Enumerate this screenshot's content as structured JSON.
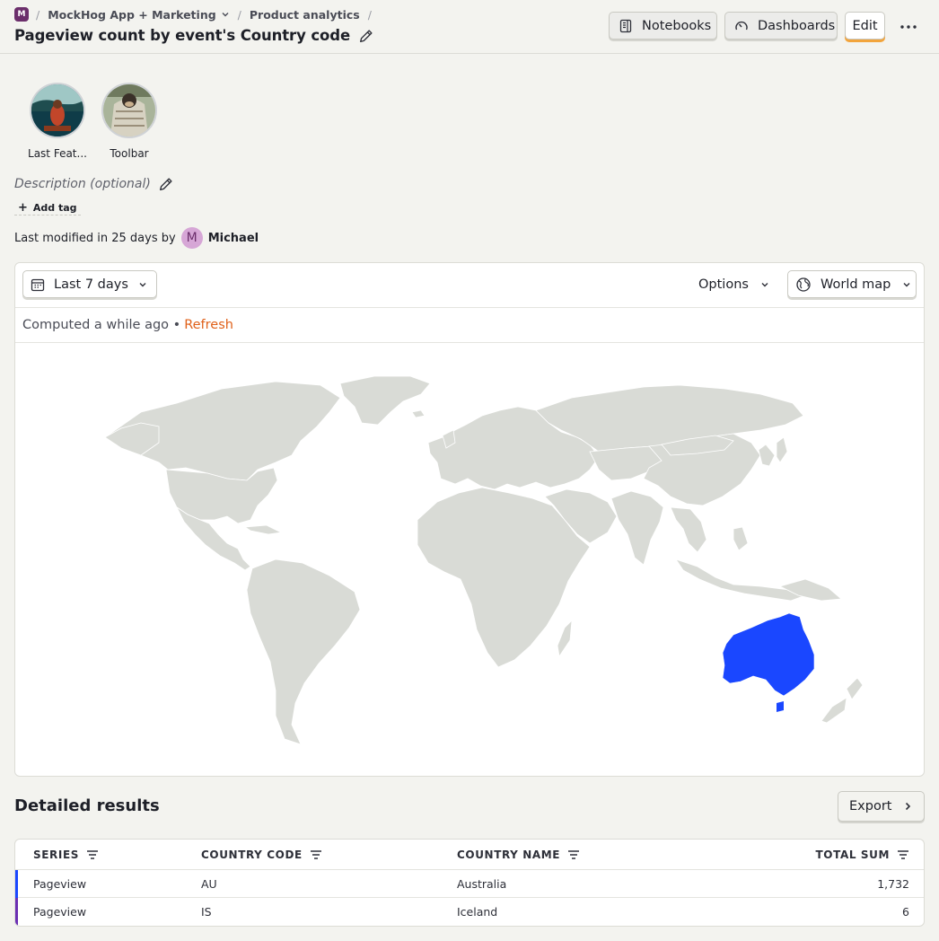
{
  "breadcrumb": {
    "project_initial": "M",
    "project": "MockHog App + Marketing",
    "section": "Product analytics"
  },
  "page": {
    "title": "Pageview count by event's Country code"
  },
  "header": {
    "notebooks_label": "Notebooks",
    "dashboards_label": "Dashboards",
    "edit_label": "Edit"
  },
  "favorites": [
    {
      "label": "Last Feat..."
    },
    {
      "label": "Toolbar"
    }
  ],
  "meta": {
    "description_placeholder": "Description (optional)",
    "add_tag_label": "Add tag",
    "modified_text": "Last modified in 25 days by",
    "author_initial": "M",
    "author_name": "Michael"
  },
  "insight": {
    "date_range": "Last 7 days",
    "options_label": "Options",
    "visualization": "World map",
    "computed_text": "Computed a while ago •",
    "refresh_label": "Refresh",
    "highlighted_country": "Australia",
    "highlight_color": "#1a47ff",
    "land_color": "#d9dbd6"
  },
  "results": {
    "title": "Detailed results",
    "export_label": "Export",
    "columns": [
      "SERIES",
      "COUNTRY CODE",
      "COUNTRY NAME",
      "TOTAL SUM"
    ],
    "rows": [
      {
        "series": "Pageview",
        "code": "AU",
        "name": "Australia",
        "total": "1,732",
        "color": "#1a47ff"
      },
      {
        "series": "Pageview",
        "code": "IS",
        "name": "Iceland",
        "total": "6",
        "color": "#6b2fb3"
      }
    ]
  }
}
